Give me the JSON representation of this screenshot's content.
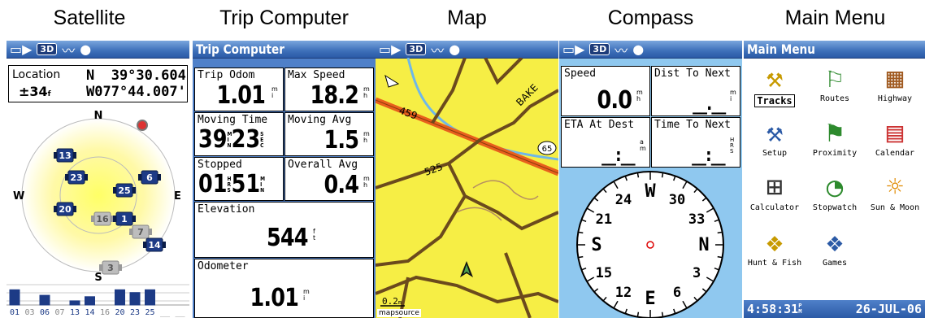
{
  "captions": [
    "Satellite",
    "Trip Computer",
    "Map",
    "Compass",
    "Main Menu"
  ],
  "status": {
    "mode": "3D"
  },
  "satellite": {
    "location_label": "Location",
    "accuracy": "±34",
    "accuracy_unit": "f",
    "lat": "N  39°30.604'",
    "lon": "W077°44.007'",
    "compass": {
      "n": "N",
      "s": "S",
      "e": "E",
      "w": "W"
    },
    "sats": [
      "13",
      "23",
      "6",
      "25",
      "20",
      "16",
      "1",
      "7",
      "14",
      "3"
    ],
    "sat_ids": [
      "01",
      "03",
      "06",
      "07",
      "13",
      "14",
      "16",
      "20",
      "23",
      "25",
      "__",
      "__"
    ],
    "signal_levels": [
      0.55,
      0,
      0.35,
      0,
      0.15,
      0.3,
      0,
      0.55,
      0.45,
      0.55,
      0,
      0
    ]
  },
  "trip": {
    "title": "Trip Computer",
    "fields": [
      {
        "label": "Trip Odom",
        "value": "1.01",
        "unit": "m i"
      },
      {
        "label": "Max Speed",
        "value": "18.2",
        "unit": "m h"
      },
      {
        "label": "Moving Time",
        "value": "39",
        "value2": "23",
        "unit": "M I N",
        "unit2": "S E C"
      },
      {
        "label": "Moving Avg",
        "value": "1.5",
        "unit": "m h"
      },
      {
        "label": "Stopped",
        "value": "01",
        "value2": "51",
        "unit": "H R S",
        "unit2": "M I N"
      },
      {
        "label": "Overall Avg",
        "value": "0.4",
        "unit": "m h"
      },
      {
        "label": "Elevation",
        "value": "544",
        "unit": "f t"
      },
      {
        "label": "Odometer",
        "value": "1.01",
        "unit": "m i"
      }
    ]
  },
  "map": {
    "roads": [
      "BAKE",
      "459",
      "525",
      "65"
    ],
    "scale": "0.2",
    "scale_unit": "m",
    "source": "mapsource"
  },
  "compass": {
    "fields": [
      {
        "label": "Speed",
        "value": "0.0",
        "unit": "m h"
      },
      {
        "label": "Dist To Next",
        "value": "__.__",
        "unit": "m i"
      },
      {
        "label": "ETA At Dest",
        "value": "__:__",
        "unit": "a m"
      },
      {
        "label": "Time To Next",
        "value": "__:__",
        "unit": "H R S"
      }
    ],
    "dial": [
      "W",
      "30",
      "33",
      "N",
      "3",
      "6",
      "E",
      "12",
      "15",
      "S",
      "21",
      "24"
    ]
  },
  "menu": {
    "title": "Main Menu",
    "items": [
      {
        "label": "Tracks",
        "icon": "tracks-icon",
        "glyph": "⚒"
      },
      {
        "label": "Routes",
        "icon": "routes-icon",
        "glyph": "⚐"
      },
      {
        "label": "Highway",
        "icon": "highway-icon",
        "glyph": "▦"
      },
      {
        "label": "Setup",
        "icon": "setup-icon",
        "glyph": "⚒"
      },
      {
        "label": "Proximity",
        "icon": "proximity-icon",
        "glyph": "⚑"
      },
      {
        "label": "Calendar",
        "icon": "calendar-icon",
        "glyph": "▤"
      },
      {
        "label": "Calculator",
        "icon": "calculator-icon",
        "glyph": "⊞"
      },
      {
        "label": "Stopwatch",
        "icon": "stopwatch-icon",
        "glyph": "◔"
      },
      {
        "label": "Sun & Moon",
        "icon": "sun-moon-icon",
        "glyph": "☼"
      },
      {
        "label": "Hunt & Fish",
        "icon": "hunt-fish-icon",
        "glyph": "❖"
      },
      {
        "label": "Games",
        "icon": "games-icon",
        "glyph": "❖"
      }
    ],
    "time": "4:58:31",
    "time_suffix": "P M",
    "date": "26-JUL-06"
  },
  "colors": {
    "titlebar": "#3d6fb9",
    "map_bg": "#f6ee45",
    "compass_bg": "#8fc8ef",
    "road": "#6b4a1d",
    "highway": "#e8601c"
  }
}
